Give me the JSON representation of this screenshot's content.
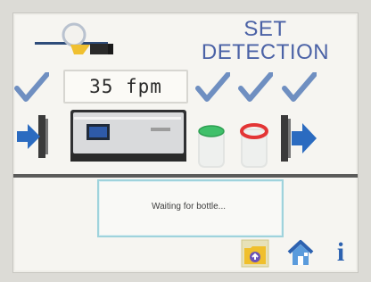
{
  "header": {
    "title_line1": "SET",
    "title_line2": "DETECTION"
  },
  "speed": {
    "display": "35 fpm"
  },
  "status": {
    "message": "Waiting for bottle..."
  },
  "toolbar": {
    "info_glyph": "i"
  },
  "icons": [
    "detector-sensor-icon",
    "check-icon",
    "entry-arrow-icon",
    "conveyor-machine-icon",
    "green-detection-icon",
    "red-detection-icon",
    "exit-arrow-icon",
    "folder-icon",
    "home-icon",
    "info-icon"
  ],
  "colors": {
    "title": "#4b62a6",
    "check": "#5a7fb6",
    "arrow": "#2b6bc0",
    "status_border": "#9fd3dc",
    "green_marker": "#42c16a",
    "red_marker": "#e23b3b"
  }
}
